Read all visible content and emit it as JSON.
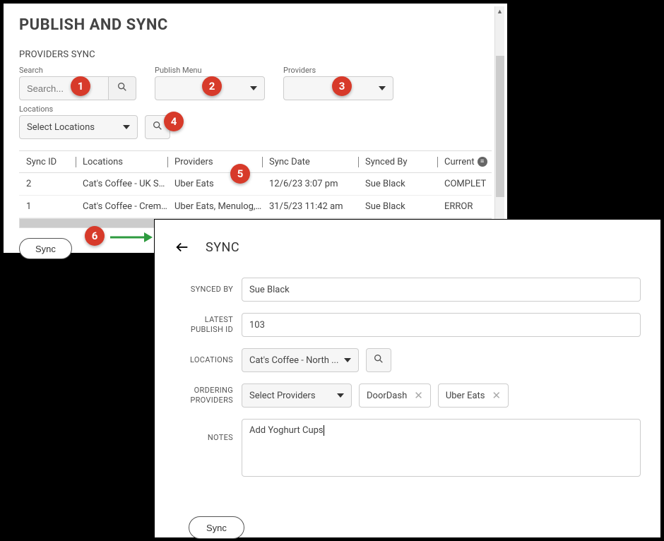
{
  "panel1": {
    "title": "PUBLISH AND SYNC",
    "subtitle": "PROVIDERS SYNC",
    "filters": {
      "search_label": "Search",
      "search_placeholder": "Search...",
      "publish_menu_label": "Publish Menu",
      "publish_menu_value": "",
      "providers_label": "Providers",
      "providers_value": "",
      "locations_label": "Locations",
      "locations_value": "Select Locations"
    },
    "table": {
      "headers": {
        "sync_id": "Sync ID",
        "locations": "Locations",
        "providers": "Providers",
        "sync_date": "Sync Date",
        "synced_by": "Synced By",
        "current": "Current"
      },
      "rows": [
        {
          "id": "2",
          "locations": "Cat's Coffee - UK So...",
          "providers": "Uber Eats",
          "sync_date": "12/6/23 3:07 pm",
          "synced_by": "Sue Black",
          "current": "COMPLET"
        },
        {
          "id": "1",
          "locations": "Cat's Coffee - Cremo...",
          "providers": "Uber Eats, Menulog, ...",
          "sync_date": "31/5/23 11:42 am",
          "synced_by": "Sue Black",
          "current": "ERROR"
        }
      ]
    },
    "sync_button": "Sync"
  },
  "panel2": {
    "title": "SYNC",
    "labels": {
      "synced_by": "SYNCED BY",
      "latest_publish_id": "LATEST PUBLISH ID",
      "locations": "LOCATIONS",
      "ordering_providers": "ORDERING PROVIDERS",
      "notes": "NOTES"
    },
    "values": {
      "synced_by": "Sue Black",
      "latest_publish_id": "103",
      "locations_selected": "Cat's Coffee - North ...",
      "providers_placeholder": "Select Providers",
      "provider_chips": [
        "DoorDash",
        "Uber Eats"
      ],
      "notes": "Add Yoghurt Cups"
    },
    "sync_button": "Sync"
  },
  "badges": [
    "1",
    "2",
    "3",
    "4",
    "5",
    "6"
  ],
  "colors": {
    "badge": "#d73a2a",
    "arrow": "#2e9b3f"
  }
}
